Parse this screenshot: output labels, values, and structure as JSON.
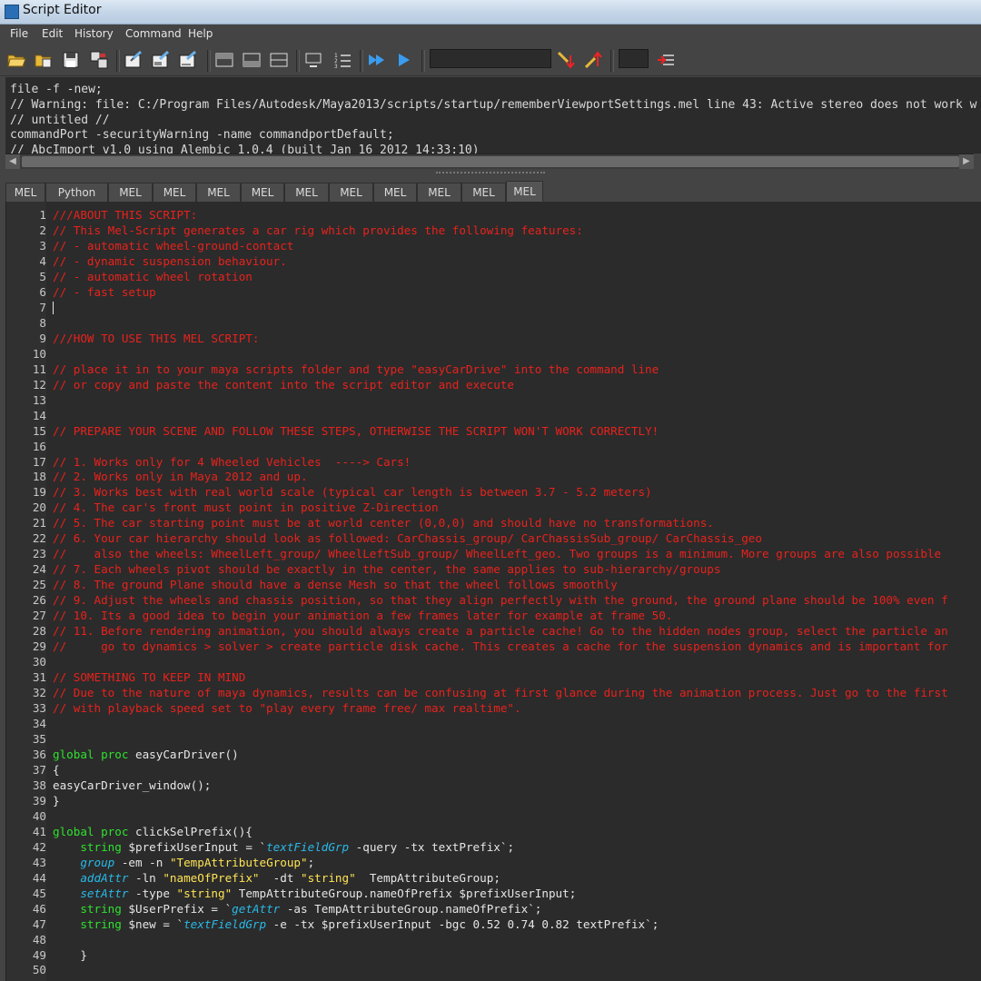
{
  "window": {
    "title": "Script Editor"
  },
  "menu": [
    "File",
    "Edit",
    "History",
    "Command",
    "Help"
  ],
  "toolbar_icons": [
    "open-script-icon",
    "source-script-icon",
    "save-script-icon",
    "save-to-shelf-icon",
    "clear-history-icon",
    "clear-input-icon",
    "clear-all-icon",
    "show-history-icon",
    "show-input-icon",
    "show-both-icon",
    "echo-all-commands-icon",
    "show-line-numbers-icon",
    "execute-all-icon",
    "execute-icon",
    "search-down-icon",
    "search-up-icon",
    "goto-line-icon"
  ],
  "history_lines": [
    "file -f -new;",
    "// Warning: file: C:/Program Files/Autodesk/Maya2013/scripts/startup/rememberViewportSettings.mel line 43: Active stereo does not work w",
    "// untitled //",
    "commandPort -securityWarning -name commandportDefault;",
    "// AbcImport v1.0 using Alembic 1.0.4 (built Jan 16 2012 14:33:10)"
  ],
  "tabs": [
    "MEL",
    "Python",
    "MEL",
    "MEL",
    "MEL",
    "MEL",
    "MEL",
    "MEL",
    "MEL",
    "MEL",
    "MEL",
    "MEL"
  ],
  "active_tab_index": 11,
  "code_lines": [
    {
      "n": "1",
      "parts": [
        {
          "c": "comment",
          "t": "///ABOUT THIS SCRIPT:"
        }
      ]
    },
    {
      "n": "2",
      "parts": [
        {
          "c": "comment",
          "t": "// This Mel-Script generates a car rig which provides the following features:"
        }
      ]
    },
    {
      "n": "3",
      "parts": [
        {
          "c": "comment",
          "t": "// - automatic wheel-ground-contact"
        }
      ]
    },
    {
      "n": "4",
      "parts": [
        {
          "c": "comment",
          "t": "// - dynamic suspension behaviour."
        }
      ]
    },
    {
      "n": "5",
      "parts": [
        {
          "c": "comment",
          "t": "// - automatic wheel rotation"
        }
      ]
    },
    {
      "n": "6",
      "parts": [
        {
          "c": "comment",
          "t": "// - fast setup"
        }
      ]
    },
    {
      "n": "7",
      "parts": [],
      "caret": true
    },
    {
      "n": "8",
      "parts": []
    },
    {
      "n": "9",
      "parts": [
        {
          "c": "comment",
          "t": "///HOW TO USE THIS MEL SCRIPT:"
        }
      ]
    },
    {
      "n": "10",
      "parts": []
    },
    {
      "n": "11",
      "parts": [
        {
          "c": "comment",
          "t": "// place it in to your maya scripts folder and type \"easyCarDrive\" into the command line"
        }
      ]
    },
    {
      "n": "12",
      "parts": [
        {
          "c": "comment",
          "t": "// or copy and paste the content into the script editor and execute"
        }
      ]
    },
    {
      "n": "13",
      "parts": []
    },
    {
      "n": "14",
      "parts": []
    },
    {
      "n": "15",
      "parts": [
        {
          "c": "comment",
          "t": "// PREPARE YOUR SCENE AND FOLLOW THESE STEPS, OTHERWISE THE SCRIPT WON'T WORK CORRECTLY!"
        }
      ]
    },
    {
      "n": "16",
      "parts": []
    },
    {
      "n": "17",
      "parts": [
        {
          "c": "comment",
          "t": "// 1. Works only for 4 Wheeled Vehicles  ----> Cars!"
        }
      ]
    },
    {
      "n": "18",
      "parts": [
        {
          "c": "comment",
          "t": "// 2. Works only in Maya 2012 and up."
        }
      ]
    },
    {
      "n": "19",
      "parts": [
        {
          "c": "comment",
          "t": "// 3. Works best with real world scale (typical car length is between 3.7 - 5.2 meters)"
        }
      ]
    },
    {
      "n": "20",
      "parts": [
        {
          "c": "comment",
          "t": "// 4. The car's front must point in positive Z-Direction"
        }
      ]
    },
    {
      "n": "21",
      "parts": [
        {
          "c": "comment",
          "t": "// 5. The car starting point must be at world center (0,0,0) and should have no transformations."
        }
      ]
    },
    {
      "n": "22",
      "parts": [
        {
          "c": "comment",
          "t": "// 6. Your car hierarchy should look as followed: CarChassis_group/ CarChassisSub_group/ CarChassis_geo"
        }
      ]
    },
    {
      "n": "23",
      "parts": [
        {
          "c": "comment",
          "t": "//    also the wheels: WheelLeft_group/ WheelLeftSub_group/ WheelLeft_geo. Two groups is a minimum. More groups are also possible"
        }
      ]
    },
    {
      "n": "24",
      "parts": [
        {
          "c": "comment",
          "t": "// 7. Each wheels pivot should be exactly in the center, the same applies to sub-hierarchy/groups"
        }
      ]
    },
    {
      "n": "25",
      "parts": [
        {
          "c": "comment",
          "t": "// 8. The ground Plane should have a dense Mesh so that the wheel follows smoothly"
        }
      ]
    },
    {
      "n": "26",
      "parts": [
        {
          "c": "comment",
          "t": "// 9. Adjust the wheels and chassis position, so that they align perfectly with the ground, the ground plane should be 100% even f"
        }
      ]
    },
    {
      "n": "27",
      "parts": [
        {
          "c": "comment",
          "t": "// 10. Its a good idea to begin your animation a few frames later for example at frame 50."
        }
      ]
    },
    {
      "n": "28",
      "parts": [
        {
          "c": "comment",
          "t": "// 11. Before rendering animation, you should always create a particle cache! Go to the hidden nodes group, select the particle an"
        }
      ]
    },
    {
      "n": "29",
      "parts": [
        {
          "c": "comment",
          "t": "//     go to dynamics > solver > create particle disk cache. This creates a cache for the suspension dynamics and is important for"
        }
      ]
    },
    {
      "n": "30",
      "parts": []
    },
    {
      "n": "31",
      "parts": [
        {
          "c": "comment",
          "t": "// SOMETHING TO KEEP IN MIND"
        }
      ]
    },
    {
      "n": "32",
      "parts": [
        {
          "c": "comment",
          "t": "// Due to the nature of maya dynamics, results can be confusing at first glance during the animation process. Just go to the first"
        }
      ]
    },
    {
      "n": "33",
      "parts": [
        {
          "c": "comment",
          "t": "// with playback speed set to \"play every frame free/ max realtime\"."
        }
      ]
    },
    {
      "n": "34",
      "parts": []
    },
    {
      "n": "35",
      "parts": []
    },
    {
      "n": "36",
      "parts": [
        {
          "c": "kw",
          "t": "global proc"
        },
        {
          "c": "plain",
          "t": " easyCarDriver()"
        }
      ]
    },
    {
      "n": "37",
      "parts": [
        {
          "c": "plain",
          "t": "{"
        }
      ]
    },
    {
      "n": "38",
      "parts": [
        {
          "c": "plain",
          "t": "easyCarDriver_window();"
        }
      ]
    },
    {
      "n": "39",
      "parts": [
        {
          "c": "plain",
          "t": "}"
        }
      ]
    },
    {
      "n": "40",
      "parts": []
    },
    {
      "n": "41",
      "parts": [
        {
          "c": "kw",
          "t": "global proc"
        },
        {
          "c": "plain",
          "t": " clickSelPrefix(){"
        }
      ]
    },
    {
      "n": "42",
      "parts": [
        {
          "c": "plain",
          "t": "    "
        },
        {
          "c": "kw",
          "t": "string"
        },
        {
          "c": "plain",
          "t": " $prefixUserInput = `"
        },
        {
          "c": "fn",
          "t": "textFieldGrp"
        },
        {
          "c": "plain",
          "t": " -query -tx textPrefix`;"
        }
      ]
    },
    {
      "n": "43",
      "parts": [
        {
          "c": "plain",
          "t": "    "
        },
        {
          "c": "fn",
          "t": "group"
        },
        {
          "c": "plain",
          "t": " -em -n "
        },
        {
          "c": "str",
          "t": "\"TempAttributeGroup\""
        },
        {
          "c": "plain",
          "t": ";"
        }
      ]
    },
    {
      "n": "44",
      "parts": [
        {
          "c": "plain",
          "t": "    "
        },
        {
          "c": "fn",
          "t": "addAttr"
        },
        {
          "c": "plain",
          "t": " -ln "
        },
        {
          "c": "str",
          "t": "\"nameOfPrefix\""
        },
        {
          "c": "plain",
          "t": "  -dt "
        },
        {
          "c": "str",
          "t": "\"string\""
        },
        {
          "c": "plain",
          "t": "  TempAttributeGroup;"
        }
      ]
    },
    {
      "n": "45",
      "parts": [
        {
          "c": "plain",
          "t": "    "
        },
        {
          "c": "fn",
          "t": "setAttr"
        },
        {
          "c": "plain",
          "t": " -type "
        },
        {
          "c": "str",
          "t": "\"string\""
        },
        {
          "c": "plain",
          "t": " TempAttributeGroup.nameOfPrefix $prefixUserInput;"
        }
      ]
    },
    {
      "n": "46",
      "parts": [
        {
          "c": "plain",
          "t": "    "
        },
        {
          "c": "kw",
          "t": "string"
        },
        {
          "c": "plain",
          "t": " $UserPrefix = `"
        },
        {
          "c": "fn",
          "t": "getAttr"
        },
        {
          "c": "plain",
          "t": " -as TempAttributeGroup.nameOfPrefix`;"
        }
      ]
    },
    {
      "n": "47",
      "parts": [
        {
          "c": "plain",
          "t": "    "
        },
        {
          "c": "kw",
          "t": "string"
        },
        {
          "c": "plain",
          "t": " $new = `"
        },
        {
          "c": "fn",
          "t": "textFieldGrp"
        },
        {
          "c": "plain",
          "t": " -e -tx $prefixUserInput -bgc 0.52 0.74 0.82 textPrefix`;"
        }
      ]
    },
    {
      "n": "48",
      "parts": []
    },
    {
      "n": "49",
      "parts": [
        {
          "c": "plain",
          "t": "    }"
        }
      ]
    },
    {
      "n": "50",
      "parts": []
    }
  ]
}
